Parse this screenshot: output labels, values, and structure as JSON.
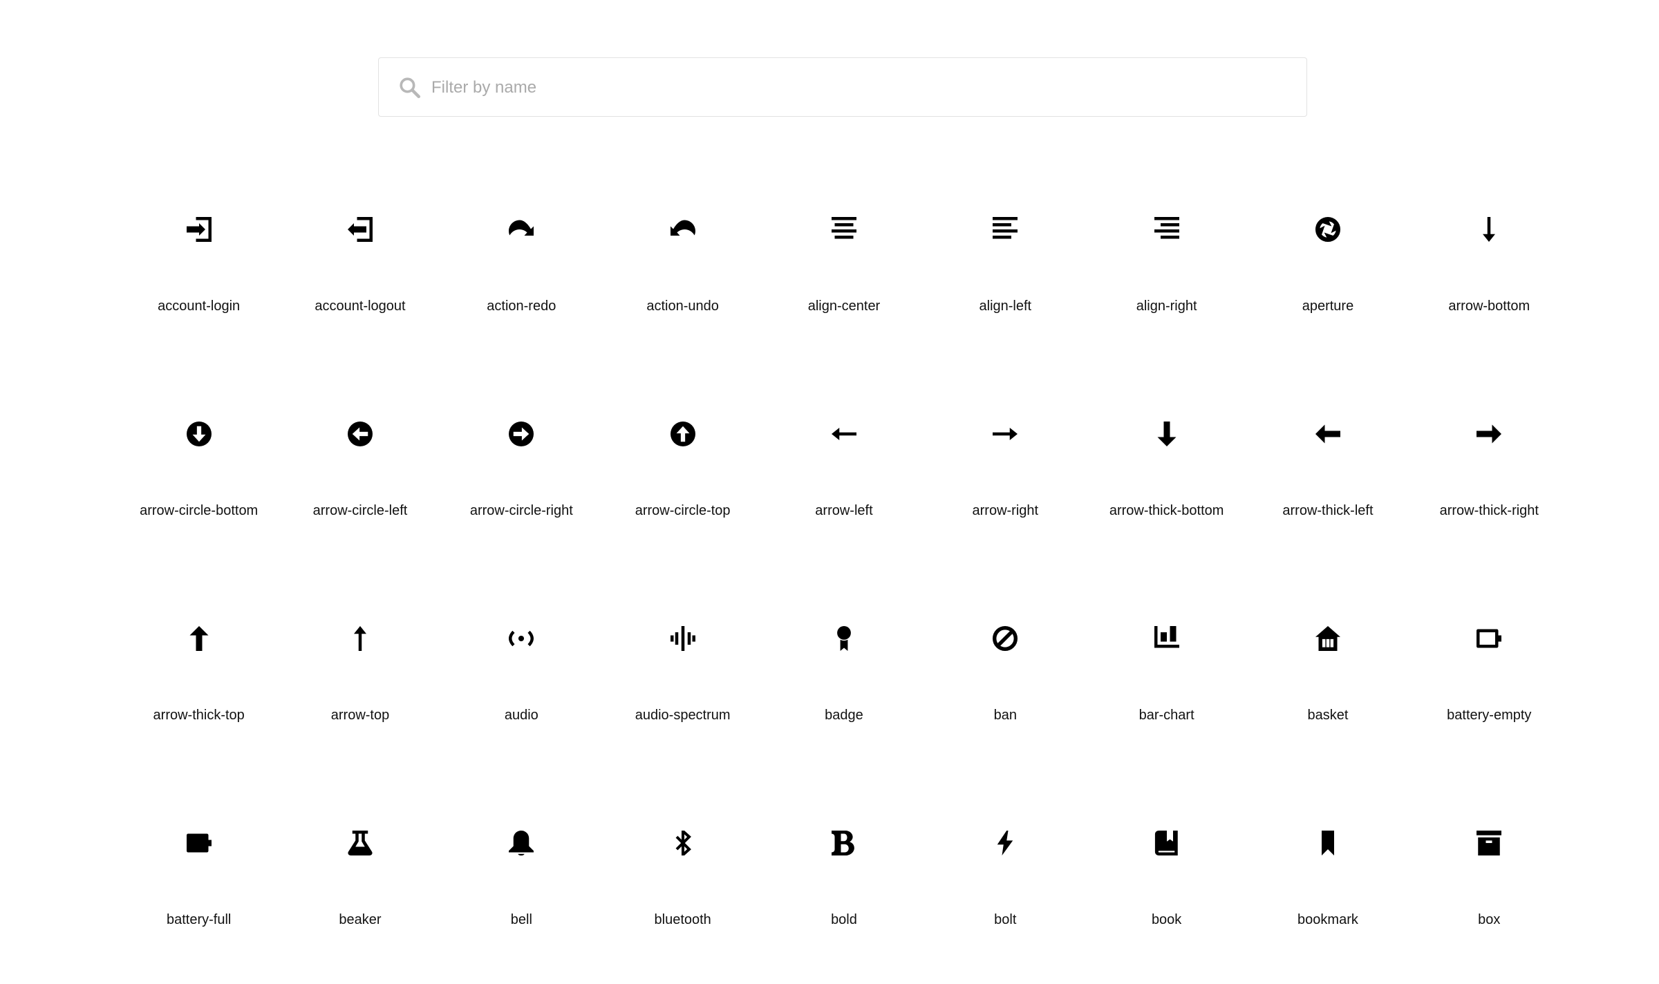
{
  "search": {
    "placeholder": "Filter by name"
  },
  "icons": [
    {
      "label": "account-login",
      "icon": "account-login-icon"
    },
    {
      "label": "account-logout",
      "icon": "account-logout-icon"
    },
    {
      "label": "action-redo",
      "icon": "action-redo-icon"
    },
    {
      "label": "action-undo",
      "icon": "action-undo-icon"
    },
    {
      "label": "align-center",
      "icon": "align-center-icon"
    },
    {
      "label": "align-left",
      "icon": "align-left-icon"
    },
    {
      "label": "align-right",
      "icon": "align-right-icon"
    },
    {
      "label": "aperture",
      "icon": "aperture-icon"
    },
    {
      "label": "arrow-bottom",
      "icon": "arrow-bottom-icon"
    },
    {
      "label": "arrow-circle-bottom",
      "icon": "arrow-circle-bottom-icon"
    },
    {
      "label": "arrow-circle-left",
      "icon": "arrow-circle-left-icon"
    },
    {
      "label": "arrow-circle-right",
      "icon": "arrow-circle-right-icon"
    },
    {
      "label": "arrow-circle-top",
      "icon": "arrow-circle-top-icon"
    },
    {
      "label": "arrow-left",
      "icon": "arrow-left-icon"
    },
    {
      "label": "arrow-right",
      "icon": "arrow-right-icon"
    },
    {
      "label": "arrow-thick-bottom",
      "icon": "arrow-thick-bottom-icon"
    },
    {
      "label": "arrow-thick-left",
      "icon": "arrow-thick-left-icon"
    },
    {
      "label": "arrow-thick-right",
      "icon": "arrow-thick-right-icon"
    },
    {
      "label": "arrow-thick-top",
      "icon": "arrow-thick-top-icon"
    },
    {
      "label": "arrow-top",
      "icon": "arrow-top-icon"
    },
    {
      "label": "audio",
      "icon": "audio-icon"
    },
    {
      "label": "audio-spectrum",
      "icon": "audio-spectrum-icon"
    },
    {
      "label": "badge",
      "icon": "badge-icon"
    },
    {
      "label": "ban",
      "icon": "ban-icon"
    },
    {
      "label": "bar-chart",
      "icon": "bar-chart-icon"
    },
    {
      "label": "basket",
      "icon": "basket-icon"
    },
    {
      "label": "battery-empty",
      "icon": "battery-empty-icon"
    },
    {
      "label": "battery-full",
      "icon": "battery-full-icon"
    },
    {
      "label": "beaker",
      "icon": "beaker-icon"
    },
    {
      "label": "bell",
      "icon": "bell-icon"
    },
    {
      "label": "bluetooth",
      "icon": "bluetooth-icon"
    },
    {
      "label": "bold",
      "icon": "bold-icon"
    },
    {
      "label": "bolt",
      "icon": "bolt-icon"
    },
    {
      "label": "book",
      "icon": "book-icon"
    },
    {
      "label": "bookmark",
      "icon": "bookmark-icon"
    },
    {
      "label": "box",
      "icon": "box-icon"
    }
  ]
}
